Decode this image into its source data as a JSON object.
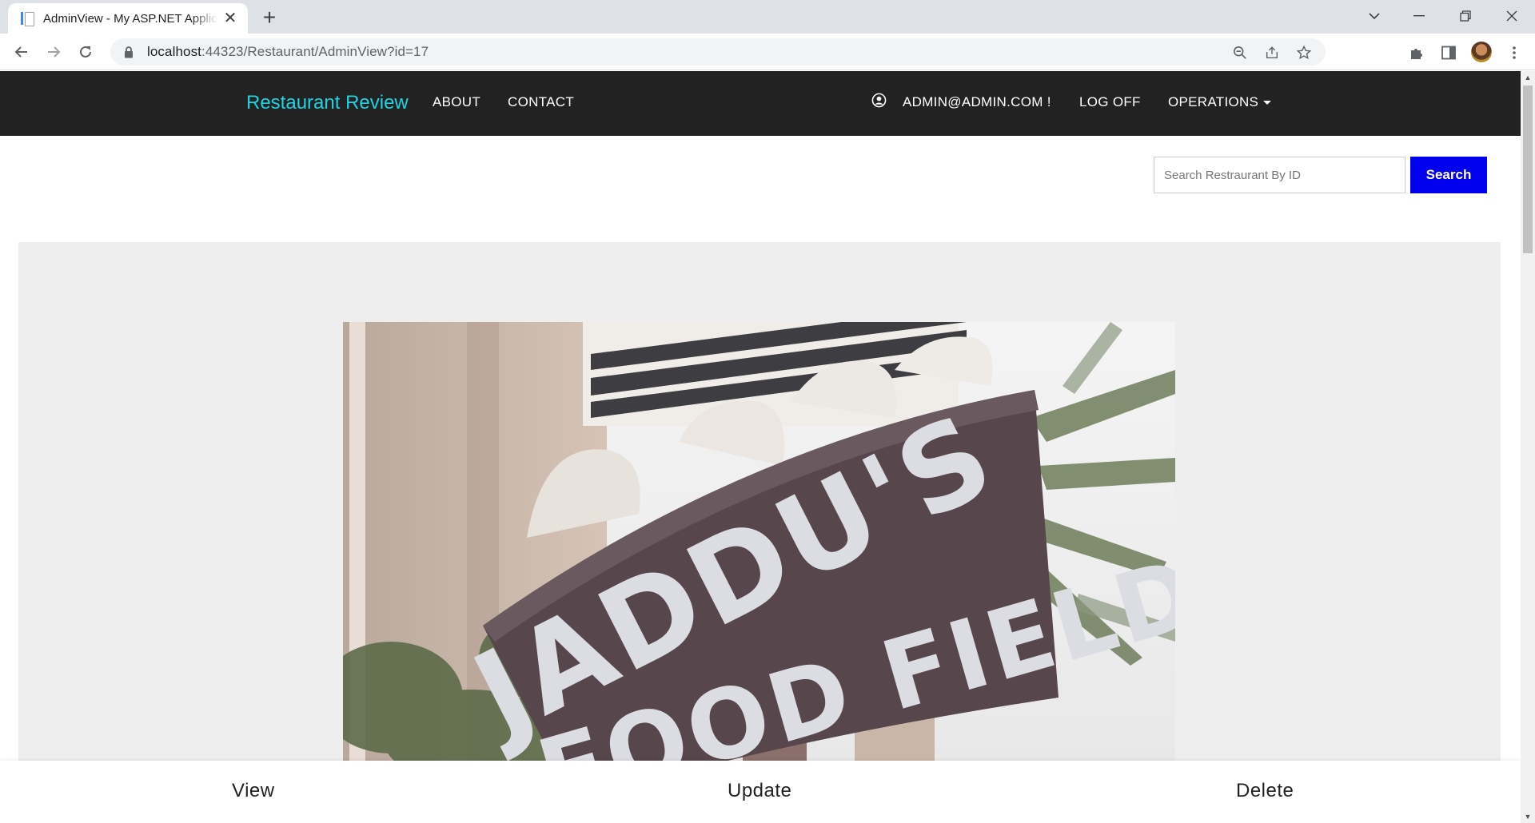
{
  "browser": {
    "tab_title": "AdminView - My ASP.NET Application",
    "url_host": "localhost",
    "url_rest": ":44323/Restaurant/AdminView?id=17",
    "new_tab_symbol": "+",
    "close_symbol": "✕"
  },
  "navbar": {
    "brand": "Restaurant Review",
    "links": [
      "ABOUT",
      "CONTACT"
    ],
    "user": "ADMIN@ADMIN.COM !",
    "log_off": "LOG OFF",
    "operations": "OPERATIONS"
  },
  "search": {
    "placeholder": "Search Restraurant By ID",
    "button": "Search"
  },
  "restaurant_image": {
    "sign_line1": "JADDU'S",
    "sign_line2": "FOOD FIELD"
  },
  "actions": {
    "view": "View",
    "update": "Update",
    "delete": "Delete"
  },
  "colors": {
    "navbar_bg": "#222222",
    "brand": "#1fd3e0",
    "search_button": "#0000ee",
    "jumbotron_bg": "#eeeeee"
  },
  "icons": [
    "back-arrow-icon",
    "forward-arrow-icon",
    "reload-icon",
    "lock-icon",
    "zoom-icon",
    "share-icon",
    "star-icon",
    "extensions-icon",
    "side-panel-icon",
    "menu-dots-icon",
    "user-circle-icon",
    "caret-down-icon"
  ]
}
